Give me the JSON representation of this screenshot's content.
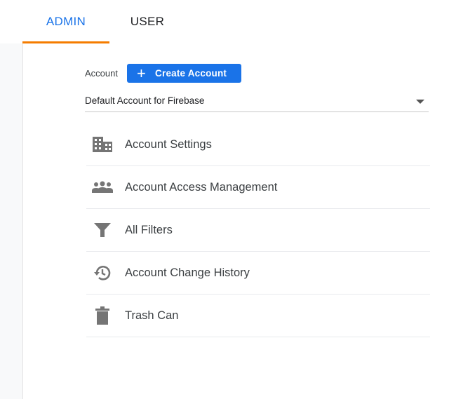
{
  "tabs": {
    "admin": "ADMIN",
    "user": "USER"
  },
  "account": {
    "label": "Account",
    "create_button": "Create Account",
    "selected": "Default Account for Firebase"
  },
  "menu": [
    {
      "label": "Account Settings",
      "icon": "building-icon"
    },
    {
      "label": "Account Access Management",
      "icon": "people-icon"
    },
    {
      "label": "All Filters",
      "icon": "filter-icon"
    },
    {
      "label": "Account Change History",
      "icon": "history-icon"
    },
    {
      "label": "Trash Can",
      "icon": "trash-icon"
    }
  ],
  "colors": {
    "primary": "#1a73e8",
    "active_tab_underline": "#f57c00",
    "icon": "#757575"
  }
}
